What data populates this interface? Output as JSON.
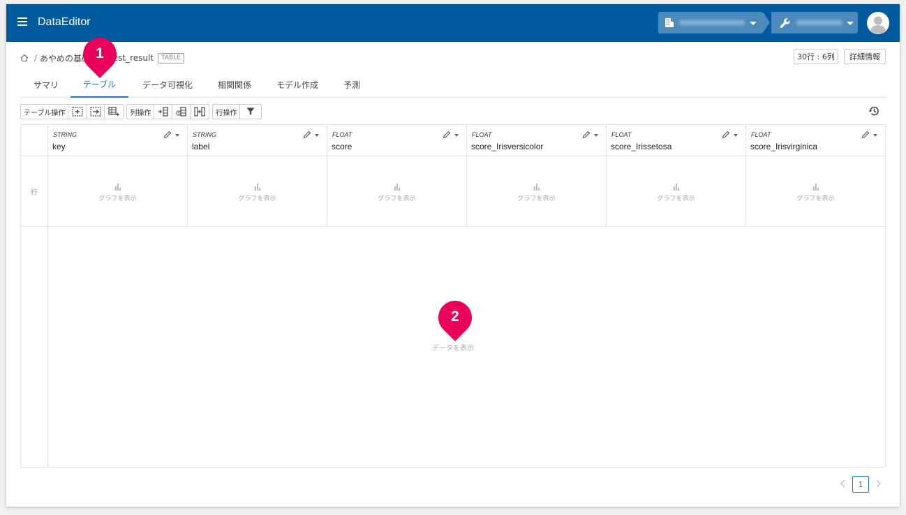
{
  "app": {
    "title": "DataEditor"
  },
  "breadcrumb": {
    "parent": "あやめの基礎",
    "current": "test_result",
    "tag": "TABLE"
  },
  "header_buttons": {
    "row_col_count": "30行 : 6列",
    "details": "詳細情報"
  },
  "tabs": [
    {
      "label": "サマリ",
      "active": false
    },
    {
      "label": "テーブル",
      "active": true
    },
    {
      "label": "データ可視化",
      "active": false
    },
    {
      "label": "相関関係",
      "active": false
    },
    {
      "label": "モデル作成",
      "active": false
    },
    {
      "label": "予測",
      "active": false
    }
  ],
  "toolbar": {
    "table_ops": "テーブル操作",
    "column_ops": "列操作",
    "row_ops": "行操作"
  },
  "grid": {
    "row_header": "行",
    "graph_label": "グラフを表示",
    "empty_text": "データを表示",
    "columns": [
      {
        "type": "STRING",
        "name": "key"
      },
      {
        "type": "STRING",
        "name": "label"
      },
      {
        "type": "FLOAT",
        "name": "score"
      },
      {
        "type": "FLOAT",
        "name": "score_Irisversicolor"
      },
      {
        "type": "FLOAT",
        "name": "score_Irissetosa"
      },
      {
        "type": "FLOAT",
        "name": "score_Irisvirginica"
      }
    ]
  },
  "annotations": {
    "pin1": "1",
    "pin2": "2"
  },
  "pagination": {
    "current_page": "1"
  },
  "colors": {
    "header_bg": "#005a9e",
    "accent": "#1976d2",
    "pin": "#e8005a"
  }
}
